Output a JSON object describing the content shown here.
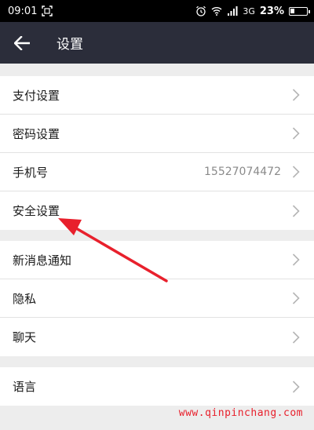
{
  "status_bar": {
    "time": "09:01",
    "network": "3G",
    "battery_percent": "23%",
    "battery_level": 0.23,
    "icons": [
      "screenshot-icon",
      "alarm-icon",
      "wifi-icon",
      "signal-icon",
      "battery-icon"
    ]
  },
  "nav": {
    "title": "设置",
    "back_icon": "arrow-left-icon"
  },
  "sections": [
    {
      "items": [
        {
          "label": "支付设置",
          "value": ""
        },
        {
          "label": "密码设置",
          "value": ""
        },
        {
          "label": "手机号",
          "value": "15527074472"
        },
        {
          "label": "安全设置",
          "value": ""
        }
      ]
    },
    {
      "items": [
        {
          "label": "新消息通知",
          "value": ""
        },
        {
          "label": "隐私",
          "value": ""
        },
        {
          "label": "聊天",
          "value": ""
        }
      ]
    },
    {
      "items": [
        {
          "label": "语言",
          "value": ""
        }
      ]
    }
  ],
  "watermark": "www.qinpinchang.com",
  "colors": {
    "nav_bg": "#2b2d3a",
    "page_bg": "#ededed",
    "annotation_arrow": "#e8202c",
    "chevron": "#b5b5b5"
  }
}
